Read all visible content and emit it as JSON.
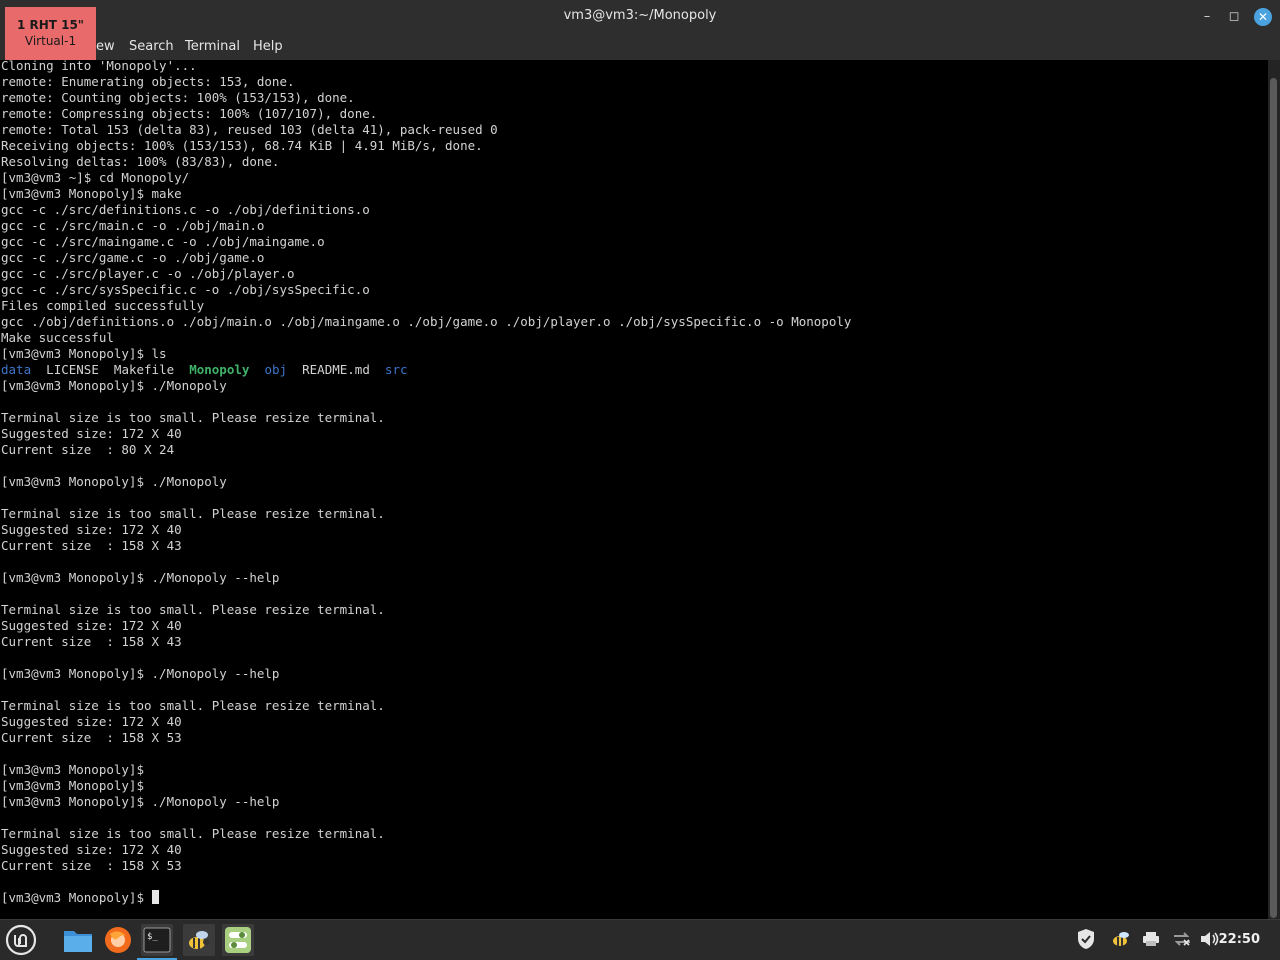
{
  "window": {
    "title": "vm3@vm3:~/Monopoly",
    "minimize_glyph": "–",
    "maximize_glyph": "◻",
    "close_glyph": "✕"
  },
  "menu": [
    {
      "label": "ew"
    },
    {
      "label": "Search"
    },
    {
      "label": "Terminal"
    },
    {
      "label": "Help"
    }
  ],
  "monitor_overlay": {
    "line1": "1  RHT 15\"",
    "line2": "Virtual-1"
  },
  "terminal": {
    "lines": [
      "Cloning into 'Monopoly'...",
      "remote: Enumerating objects: 153, done.",
      "remote: Counting objects: 100% (153/153), done.",
      "remote: Compressing objects: 100% (107/107), done.",
      "remote: Total 153 (delta 83), reused 103 (delta 41), pack-reused 0",
      "Receiving objects: 100% (153/153), 68.74 KiB | 4.91 MiB/s, done.",
      "Resolving deltas: 100% (83/83), done.",
      "[vm3@vm3 ~]$ cd Monopoly/",
      "[vm3@vm3 Monopoly]$ make",
      "gcc -c ./src/definitions.c -o ./obj/definitions.o",
      "gcc -c ./src/main.c -o ./obj/main.o",
      "gcc -c ./src/maingame.c -o ./obj/maingame.o",
      "gcc -c ./src/game.c -o ./obj/game.o",
      "gcc -c ./src/player.c -o ./obj/player.o",
      "gcc -c ./src/sysSpecific.c -o ./obj/sysSpecific.o",
      "Files compiled successfully",
      "gcc ./obj/definitions.o ./obj/main.o ./obj/maingame.o ./obj/game.o ./obj/player.o ./obj/sysSpecific.o -o Monopoly",
      "Make successful",
      "[vm3@vm3 Monopoly]$ ls",
      "__LS__",
      "[vm3@vm3 Monopoly]$ ./Monopoly",
      "",
      "Terminal size is too small. Please resize terminal.",
      "Suggested size: 172 X 40",
      "Current size  : 80 X 24",
      "",
      "[vm3@vm3 Monopoly]$ ./Monopoly",
      "",
      "Terminal size is too small. Please resize terminal.",
      "Suggested size: 172 X 40",
      "Current size  : 158 X 43",
      "",
      "[vm3@vm3 Monopoly]$ ./Monopoly --help",
      "",
      "Terminal size is too small. Please resize terminal.",
      "Suggested size: 172 X 40",
      "Current size  : 158 X 43",
      "",
      "[vm3@vm3 Monopoly]$ ./Monopoly --help",
      "",
      "Terminal size is too small. Please resize terminal.",
      "Suggested size: 172 X 40",
      "Current size  : 158 X 53",
      "",
      "[vm3@vm3 Monopoly]$",
      "[vm3@vm3 Monopoly]$",
      "[vm3@vm3 Monopoly]$ ./Monopoly --help",
      "",
      "Terminal size is too small. Please resize terminal.",
      "Suggested size: 172 X 40",
      "Current size  : 158 X 53",
      ""
    ],
    "ls_output": [
      {
        "name": "data",
        "kind": "dir"
      },
      {
        "name": "LICENSE",
        "kind": "file"
      },
      {
        "name": "Makefile",
        "kind": "file"
      },
      {
        "name": "Monopoly",
        "kind": "exec"
      },
      {
        "name": "obj",
        "kind": "dir"
      },
      {
        "name": "README.md",
        "kind": "file"
      },
      {
        "name": "src",
        "kind": "dir"
      }
    ],
    "prompt": "[vm3@vm3 Monopoly]$ "
  },
  "taskbar": {
    "apps": [
      {
        "name": "menu-icon"
      },
      {
        "name": "files-icon"
      },
      {
        "name": "firefox-icon"
      },
      {
        "name": "terminal-icon"
      },
      {
        "name": "bee-icon"
      },
      {
        "name": "settings-toggle-icon"
      }
    ],
    "tray": [
      "shield-icon",
      "bee-tray-icon",
      "printer-icon",
      "network-icon",
      "volume-icon"
    ],
    "clock": "22:50"
  },
  "colors": {
    "dir": "#3f74c9",
    "exec": "#3fb26a",
    "accent": "#4aa3df",
    "overlay": "#e86a6a"
  }
}
